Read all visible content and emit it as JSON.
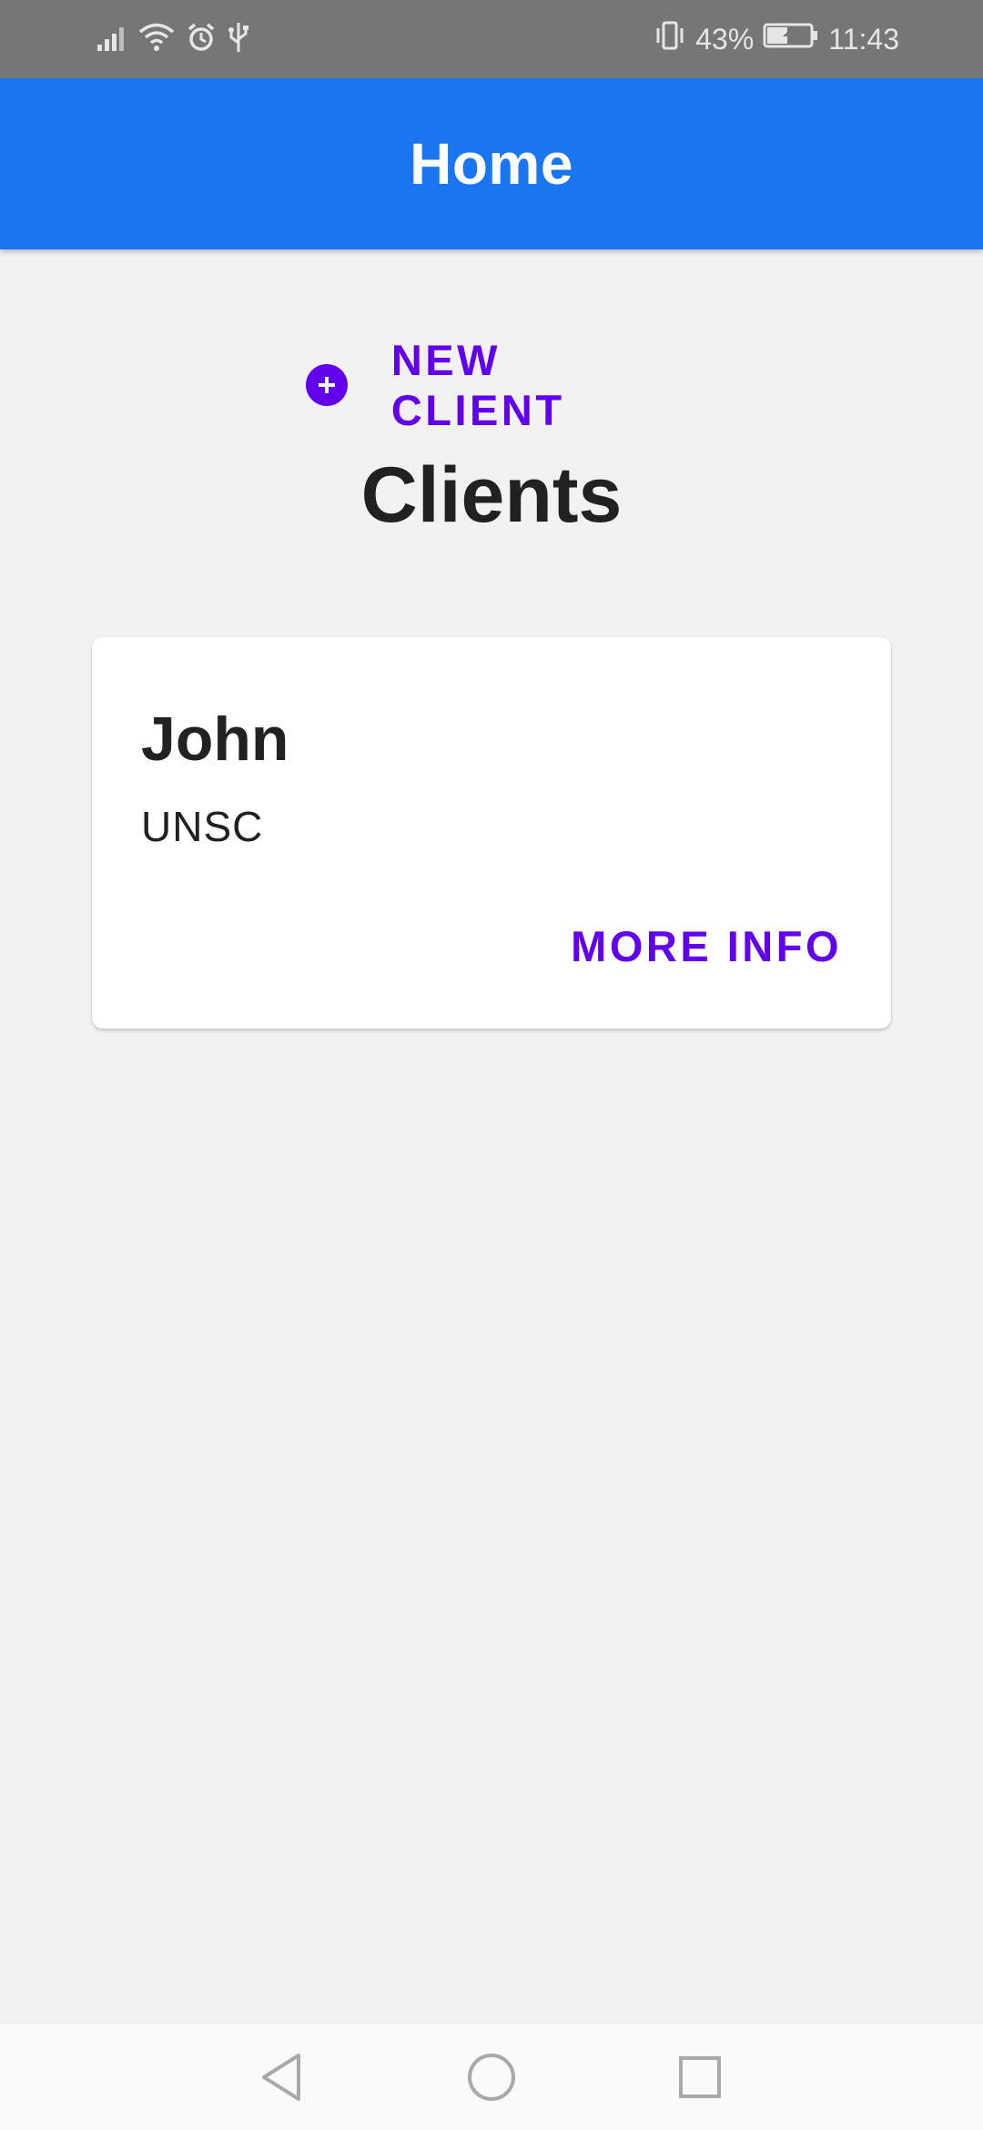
{
  "status_bar": {
    "battery_percent": "43%",
    "time": "11:43",
    "icons": [
      "signal-icon",
      "wifi-icon",
      "alarm-icon",
      "usb-icon",
      "vibrate-icon",
      "battery-charging-icon"
    ]
  },
  "app_bar": {
    "title": "Home",
    "color": "#1976f0"
  },
  "actions": {
    "new_client_label": "NEW CLIENT",
    "new_client_icon": "add-circle-icon",
    "accent_color": "#6200ee"
  },
  "main": {
    "section_title": "Clients",
    "clients": [
      {
        "name": "John",
        "company": "UNSC",
        "action_label": "MORE INFO"
      }
    ]
  },
  "nav_bar": {
    "buttons": [
      "back-icon",
      "home-icon",
      "recents-icon"
    ]
  }
}
